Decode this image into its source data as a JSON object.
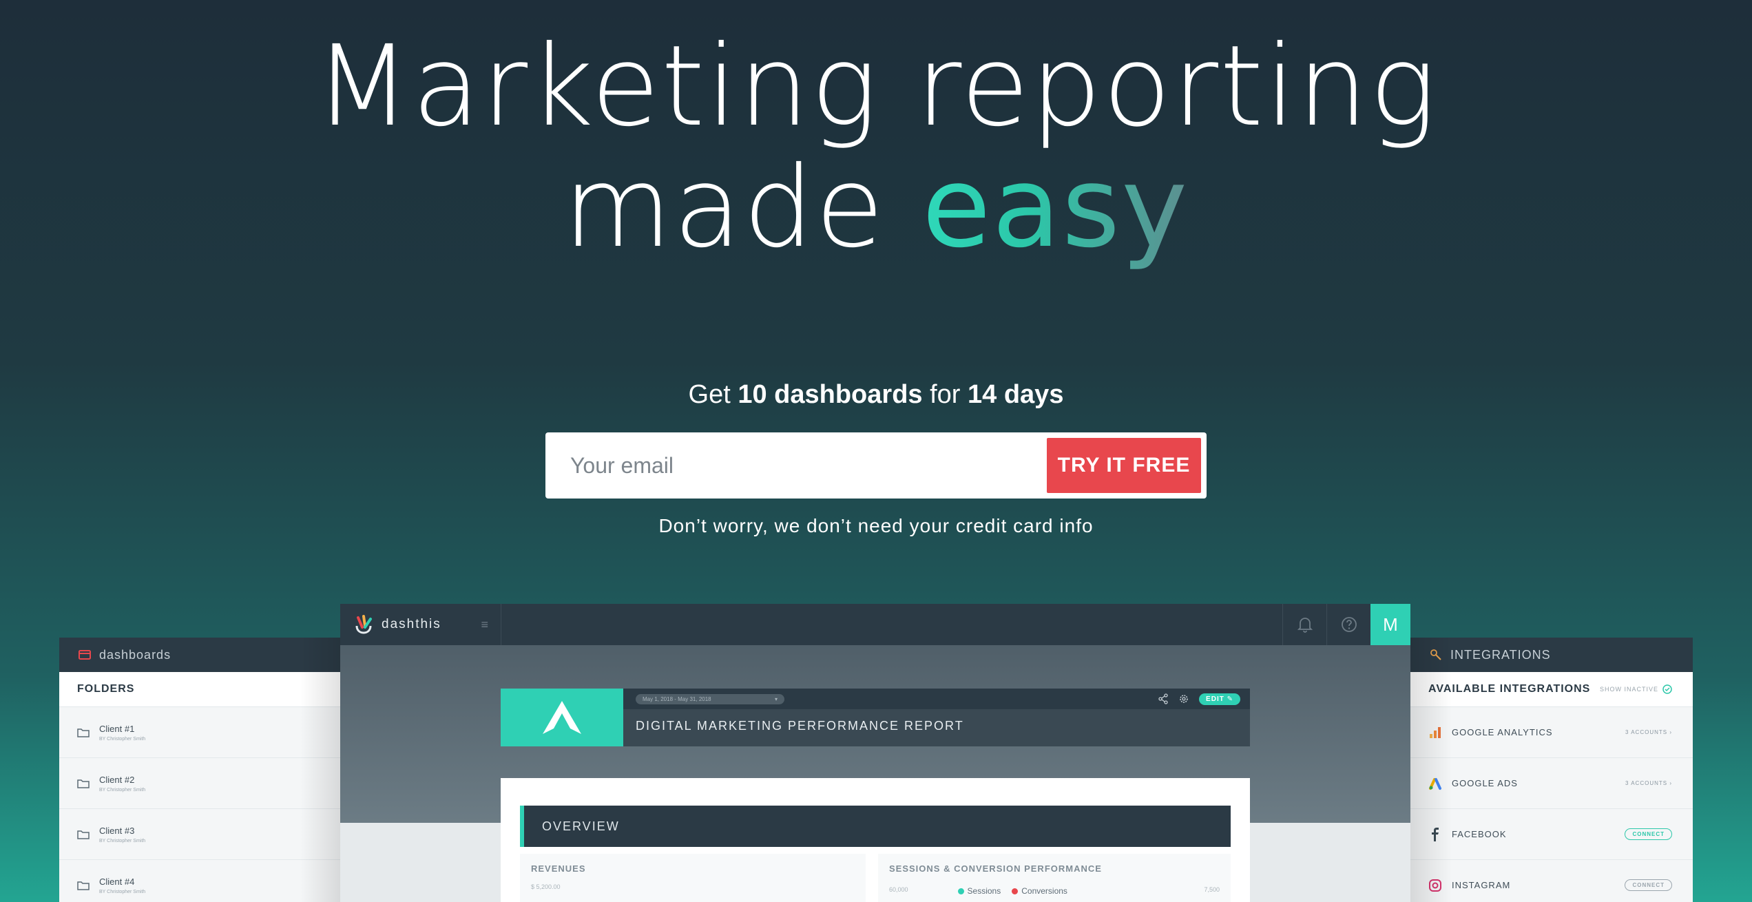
{
  "hero": {
    "line1": "Marketing reporting",
    "line2_prefix": "made ",
    "line2_accent": "easy"
  },
  "offer": {
    "prefix": "Get ",
    "count": "10 dashboards",
    "middle": " for ",
    "days": "14 days"
  },
  "signup": {
    "email_placeholder": "Your email",
    "cta_label": "TRY IT FREE"
  },
  "disclaimer": "Don’t worry, we don’t need your credit card info",
  "app": {
    "brand": "dashthis",
    "avatar_letter": "M",
    "report": {
      "date_range": "May 1, 2018 - May 31, 2018",
      "edit_label": "EDIT",
      "title": "DIGITAL MARKETING PERFORMANCE REPORT"
    },
    "overview_label": "OVERVIEW",
    "widgets": {
      "revenues": {
        "title": "REVENUES",
        "axis": "$ 5,200.00"
      },
      "sessions": {
        "title": "SESSIONS & CONVERSION PERFORMANCE",
        "axis_left": "60,000",
        "axis_right": "7,500",
        "legend": [
          "Sessions",
          "Conversions"
        ],
        "legend_colors": [
          "#2fd0b4",
          "#e8474d"
        ]
      }
    }
  },
  "dashboards_panel": {
    "header": "dashboards",
    "subheader": "FOLDERS",
    "items": [
      {
        "name": "Client #1",
        "by": "BY Christopher Smith"
      },
      {
        "name": "Client #2",
        "by": "BY Christopher Smith"
      },
      {
        "name": "Client #3",
        "by": "BY Christopher Smith"
      },
      {
        "name": "Client #4",
        "by": "BY Christopher Smith"
      }
    ]
  },
  "integrations_panel": {
    "header": "INTEGRATIONS",
    "subheader": "AVAILABLE INTEGRATIONS",
    "toggle_label": "SHOW INACTIVE",
    "items": [
      {
        "name": "GOOGLE ANALYTICS",
        "status": "3 ACCOUNTS ›"
      },
      {
        "name": "GOOGLE ADS",
        "status": "3 ACCOUNTS ›"
      },
      {
        "name": "FACEBOOK",
        "status": "CONNECT"
      },
      {
        "name": "INSTAGRAM",
        "status": "CONNECT"
      }
    ]
  },
  "colors": {
    "accent": "#2fd0b4",
    "cta": "#e8474d",
    "dark": "#2b3a45"
  }
}
